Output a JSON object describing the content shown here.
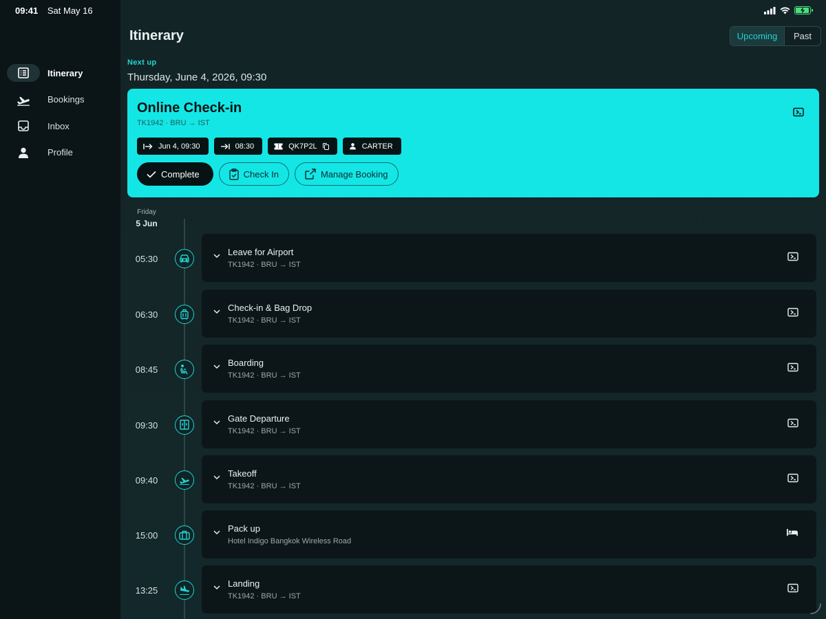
{
  "status_bar": {
    "time": "09:41",
    "date": "Sat May 16"
  },
  "sidebar": {
    "items": [
      {
        "label": "Itinerary",
        "icon": "list-icon",
        "active": true
      },
      {
        "label": "Bookings",
        "icon": "plane-departure-icon",
        "active": false
      },
      {
        "label": "Inbox",
        "icon": "inbox-icon",
        "active": false
      },
      {
        "label": "Profile",
        "icon": "person-icon",
        "active": false
      }
    ]
  },
  "header": {
    "title": "Itinerary",
    "segments": {
      "upcoming": "Upcoming",
      "past": "Past",
      "selected": "Upcoming"
    }
  },
  "next_up": {
    "label": "Next up",
    "datetime": "Thursday, June 4, 2026, 09:30",
    "card": {
      "title": "Online Check-in",
      "subtitle": "TK1942 · BRU → IST",
      "chips": {
        "start": "Jun 4, 09:30",
        "end": "08:30",
        "booking_ref": "QK7P2L",
        "passenger": "CARTER"
      },
      "actions": {
        "complete": "Complete",
        "check_in": "Check In",
        "manage": "Manage Booking"
      }
    }
  },
  "timeline": {
    "day_label": "Friday",
    "day_date": "5 Jun",
    "events": [
      {
        "time": "05:30",
        "title": "Leave for Airport",
        "subtitle": "TK1942 · BRU → IST",
        "icon": "car-icon",
        "trailing_icon": "ticket-icon"
      },
      {
        "time": "06:30",
        "title": "Check-in & Bag Drop",
        "subtitle": "TK1942 · BRU → IST",
        "icon": "luggage-icon",
        "trailing_icon": "ticket-icon"
      },
      {
        "time": "08:45",
        "title": "Boarding",
        "subtitle": "TK1942 · BRU → IST",
        "icon": "seat-icon",
        "trailing_icon": "ticket-icon"
      },
      {
        "time": "09:30",
        "title": "Gate Departure",
        "subtitle": "TK1942 · BRU → IST",
        "icon": "gate-icon",
        "trailing_icon": "ticket-icon"
      },
      {
        "time": "09:40",
        "title": "Takeoff",
        "subtitle": "TK1942 · BRU → IST",
        "icon": "plane-takeoff-icon",
        "trailing_icon": "ticket-icon"
      },
      {
        "time": "15:00",
        "title": "Pack up",
        "subtitle": "Hotel Indigo Bangkok Wireless Road",
        "icon": "suitcase-icon",
        "trailing_icon": "bed-icon"
      },
      {
        "time": "13:25",
        "title": "Landing",
        "subtitle": "TK1942 · BRU → IST",
        "icon": "plane-landing-icon",
        "trailing_icon": "ticket-icon"
      }
    ]
  },
  "colors": {
    "accent": "#14e6e6",
    "accent_text": "#22d3d1",
    "background": "#132426",
    "sidebar": "#0b1416",
    "card": "#0c1618"
  }
}
